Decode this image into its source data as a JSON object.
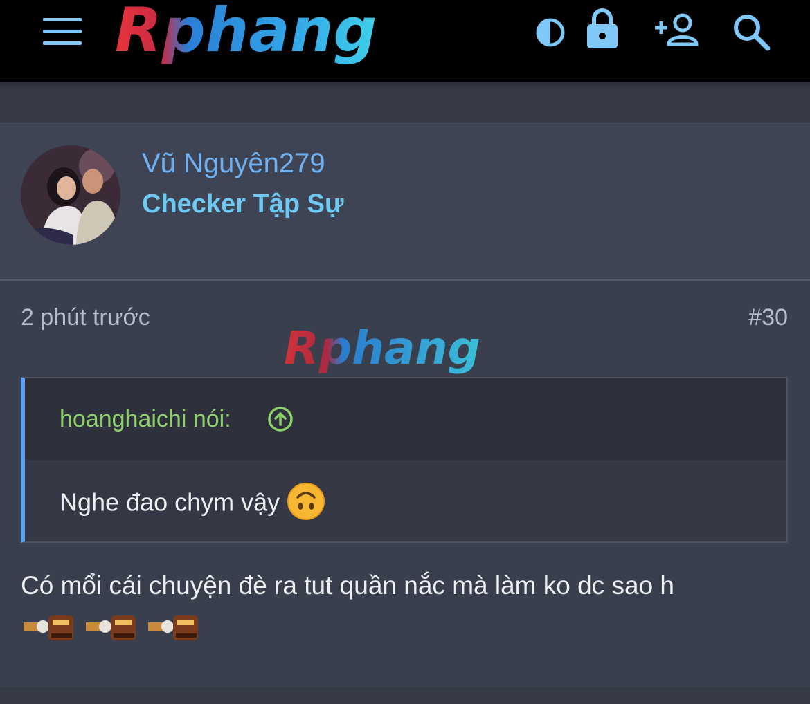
{
  "header": {
    "logo_text": "Rphang",
    "menu_icon": "hamburger-menu-icon",
    "icons": [
      "contrast-icon",
      "lock-icon",
      "add-user-icon",
      "search-icon"
    ]
  },
  "post": {
    "username": "Vũ Nguyên279",
    "user_title": "Checker Tập Sự",
    "time": "2 phút trước",
    "number": "#30",
    "watermark_text": "Rphang",
    "quote": {
      "author": "hoanghaichi nói:",
      "text": "Nghe đao chym vậy"
    },
    "body_text": "Có mổi cái chuyện đè ra tut quần nắc mà làm ko dc sao h"
  },
  "colors": {
    "accent_blue": "#6fb0f0",
    "title_cyan": "#6ec9f2",
    "quote_green": "#8ed06a",
    "quote_border": "#5d9ff0",
    "background": "#363a46"
  }
}
